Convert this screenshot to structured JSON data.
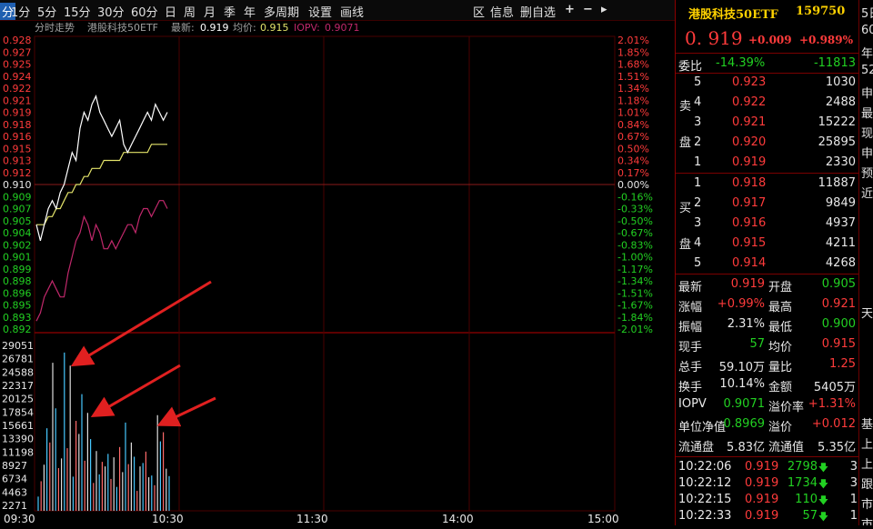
{
  "toolbar": {
    "items": [
      "分",
      "1分",
      "5分",
      "15分",
      "30分",
      "60分",
      "日",
      "周",
      "月",
      "季",
      "年",
      "多周期",
      "设置",
      "画线"
    ],
    "right_items": [
      "区",
      "信息",
      "删自选",
      "+",
      "−",
      "▸"
    ]
  },
  "chart_header": {
    "mode": "分时走势",
    "name": "港股科技50ETF",
    "latest_label": "最新:",
    "latest_value": "0.919",
    "avg_label": "均价:",
    "avg_value": "0.915",
    "iopv_label": "IOPV:",
    "iopv_value": "0.9071"
  },
  "chart_data": {
    "type": "line",
    "x_ticks": [
      "09:30",
      "10:30",
      "11:30",
      "14:00",
      "15:00"
    ],
    "price_ticks": [
      "0.928",
      "0.927",
      "0.925",
      "0.924",
      "0.922",
      "0.921",
      "0.919",
      "0.918",
      "0.916",
      "0.915",
      "0.913",
      "0.912",
      "0.910",
      "0.909",
      "0.907",
      "0.905",
      "0.904",
      "0.902",
      "0.901",
      "0.899",
      "0.898",
      "0.896",
      "0.895",
      "0.893",
      "0.892"
    ],
    "pct_ticks": [
      "2.01%",
      "1.85%",
      "1.68%",
      "1.51%",
      "1.34%",
      "1.18%",
      "1.01%",
      "0.84%",
      "0.67%",
      "0.50%",
      "0.34%",
      "0.17%",
      "0.00%",
      "-0.16%",
      "-0.33%",
      "-0.50%",
      "-0.67%",
      "-0.83%",
      "-1.00%",
      "-1.17%",
      "-1.34%",
      "-1.51%",
      "-1.67%",
      "-1.84%",
      "-2.01%"
    ],
    "prev_close": 0.91,
    "ylim": [
      0.892,
      0.928
    ],
    "price_series": [
      0.905,
      0.903,
      0.905,
      0.907,
      0.908,
      0.907,
      0.909,
      0.91,
      0.912,
      0.914,
      0.913,
      0.917,
      0.919,
      0.918,
      0.92,
      0.921,
      0.919,
      0.918,
      0.917,
      0.916,
      0.917,
      0.918,
      0.915,
      0.914,
      0.915,
      0.916,
      0.917,
      0.918,
      0.919,
      0.918,
      0.92,
      0.919,
      0.918,
      0.919
    ],
    "avg_series": [
      0.905,
      0.905,
      0.905,
      0.906,
      0.906,
      0.907,
      0.907,
      0.908,
      0.909,
      0.909,
      0.91,
      0.91,
      0.911,
      0.911,
      0.912,
      0.912,
      0.912,
      0.913,
      0.913,
      0.913,
      0.913,
      0.913,
      0.914,
      0.914,
      0.914,
      0.914,
      0.914,
      0.914,
      0.914,
      0.915,
      0.915,
      0.915,
      0.915,
      0.915
    ],
    "iopv_series": [
      0.893,
      0.894,
      0.896,
      0.897,
      0.898,
      0.897,
      0.896,
      0.896,
      0.899,
      0.901,
      0.903,
      0.904,
      0.906,
      0.905,
      0.903,
      0.905,
      0.904,
      0.902,
      0.902,
      0.903,
      0.902,
      0.903,
      0.904,
      0.905,
      0.905,
      0.904,
      0.906,
      0.907,
      0.907,
      0.906,
      0.907,
      0.908,
      0.908,
      0.907
    ],
    "volume_ticks": [
      "29051",
      "26781",
      "24588",
      "22317",
      "20125",
      "17854",
      "15661",
      "13390",
      "11198",
      "8927",
      "6734",
      "4463",
      "2271"
    ],
    "volume_max": 29051,
    "volumes": [
      2500,
      5200,
      8100,
      14500,
      12000,
      26000,
      18000,
      7500,
      9200,
      27800,
      11000,
      25500,
      6000,
      15800,
      13500,
      20500,
      8800,
      17200,
      12600,
      4900,
      10500,
      6400,
      8600,
      7800,
      10000,
      5600,
      9400,
      4200,
      11200,
      6800,
      15500,
      8200,
      12000,
      9500,
      3500,
      7800,
      8400,
      10400,
      5900,
      6200,
      4500,
      16800,
      12200,
      13800,
      7400,
      6100
    ],
    "colors": {
      "price": "#ffffff",
      "avg": "#e3e36a",
      "iopv": "#c0286b",
      "grid": "#4a0000",
      "up": "#ff3b3b",
      "down": "#22d022",
      "vol_up": "#ff6a6a",
      "vol_down": "#46c8ff",
      "arrow": "#e02020"
    }
  },
  "info": {
    "name": "港股科技50ETF",
    "code": "159750",
    "price": "0. 919",
    "change": "+0.009",
    "change_pct": "+0.989%",
    "weibi_label": "委比",
    "weibi_pct": "-14.39%",
    "weibi_diff": "-11813",
    "sell_label": [
      "卖",
      "盘"
    ],
    "buy_label": [
      "买",
      "盘"
    ],
    "asks": [
      {
        "level": "5",
        "price": "0.923",
        "vol": "1030"
      },
      {
        "level": "4",
        "price": "0.922",
        "vol": "2488"
      },
      {
        "level": "3",
        "price": "0.921",
        "vol": "15222"
      },
      {
        "level": "2",
        "price": "0.920",
        "vol": "25895"
      },
      {
        "level": "1",
        "price": "0.919",
        "vol": "2330"
      }
    ],
    "bids": [
      {
        "level": "1",
        "price": "0.918",
        "vol": "11887"
      },
      {
        "level": "2",
        "price": "0.917",
        "vol": "9849"
      },
      {
        "level": "3",
        "price": "0.916",
        "vol": "4937"
      },
      {
        "level": "4",
        "price": "0.915",
        "vol": "4211"
      },
      {
        "level": "5",
        "price": "0.914",
        "vol": "4268"
      }
    ],
    "stats": [
      {
        "l1": "最新",
        "v1": "0.919",
        "c1": "red",
        "l2": "开盘",
        "v2": "0.905",
        "c2": "green"
      },
      {
        "l1": "涨幅",
        "v1": "+0.99%",
        "c1": "red",
        "l2": "最高",
        "v2": "0.921",
        "c2": "red"
      },
      {
        "l1": "振幅",
        "v1": "2.31%",
        "c1": "white",
        "l2": "最低",
        "v2": "0.900",
        "c2": "green"
      },
      {
        "l1": "现手",
        "v1": "57",
        "c1": "green",
        "l2": "均价",
        "v2": "0.915",
        "c2": "red"
      },
      {
        "l1": "总手",
        "v1": "59.10万",
        "c1": "white",
        "l2": "量比",
        "v2": "1.25",
        "c2": "red"
      },
      {
        "l1": "换手",
        "v1": "10.14%",
        "c1": "white",
        "l2": "金额",
        "v2": "5405万",
        "c2": "white"
      },
      {
        "l1": "IOPV",
        "v1": "0.9071",
        "c1": "green",
        "l2": "溢价率",
        "v2": "+1.31%",
        "c2": "red"
      },
      {
        "l1": "单位净值",
        "v1": "0.8969",
        "c1": "green",
        "l2": "溢价",
        "v2": "+0.012",
        "c2": "red"
      },
      {
        "l1": "流通盘",
        "v1": "5.83亿",
        "c1": "white",
        "l2": "流通值",
        "v2": "5.35亿",
        "c2": "white"
      }
    ],
    "ticks": [
      {
        "time": "10:22:06",
        "price": "0.919",
        "vol": "2798",
        "n": "3"
      },
      {
        "time": "10:22:12",
        "price": "0.919",
        "vol": "1734",
        "n": "3"
      },
      {
        "time": "10:22:15",
        "price": "0.919",
        "vol": "110",
        "n": "1"
      },
      {
        "time": "10:22:33",
        "price": "0.919",
        "vol": "57",
        "n": "1"
      }
    ]
  },
  "far_panel": [
    "5日",
    "60",
    "年",
    "52",
    "申",
    "最",
    "现",
    "申",
    "预",
    "近",
    "天",
    "基",
    "上",
    "上",
    "跟",
    "市",
    "市",
    "基"
  ]
}
